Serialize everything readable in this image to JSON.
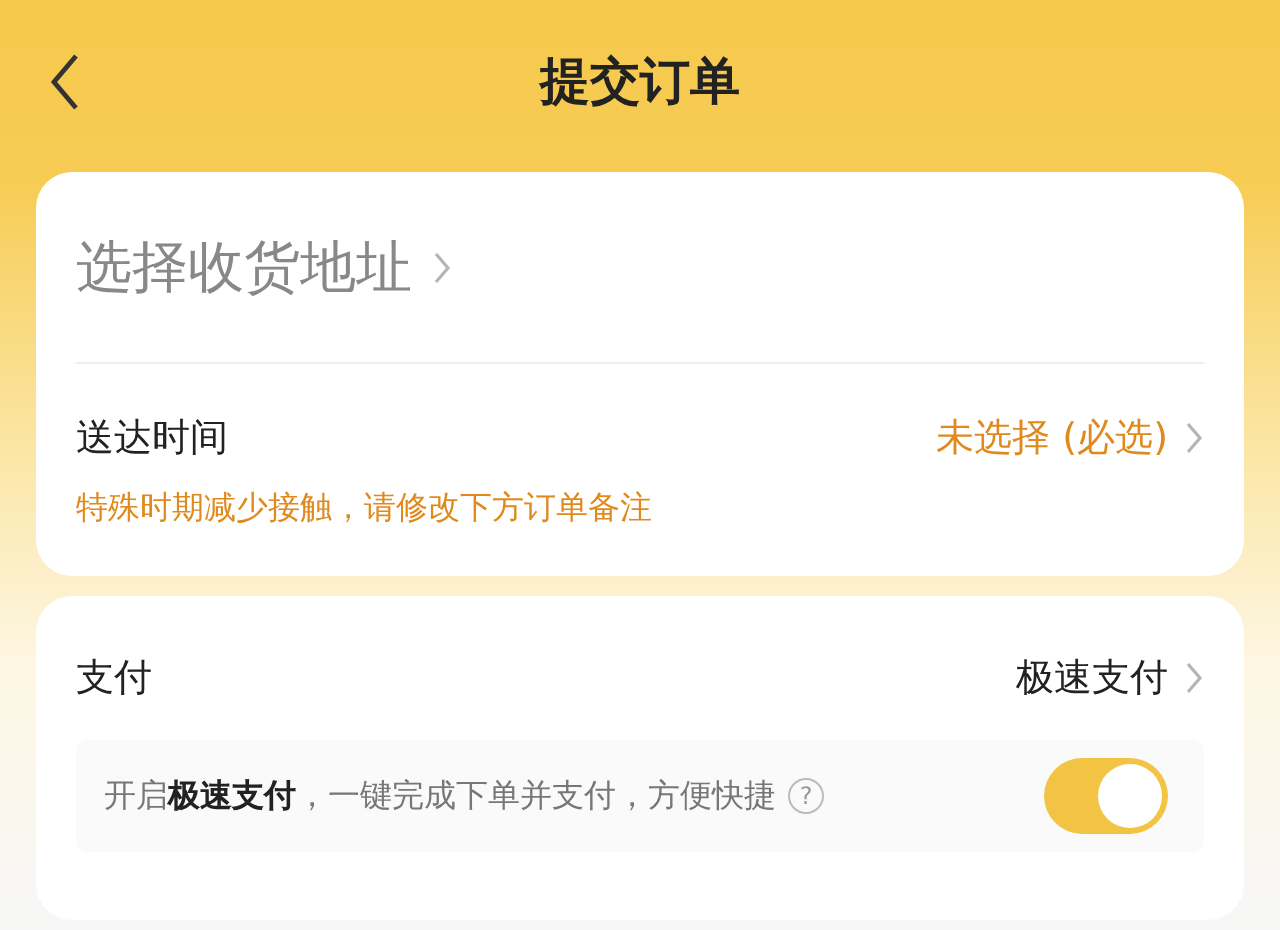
{
  "header": {
    "title": "提交订单"
  },
  "address": {
    "label": "选择收货地址"
  },
  "delivery": {
    "label": "送达时间",
    "value": "未选择 (必选)",
    "hint": "特殊时期减少接触，请修改下方订单备注"
  },
  "payment": {
    "label": "支付",
    "value": "极速支付"
  },
  "fast_pay": {
    "text": "开启**极速支付**，一键完成下单并支付，方便快捷",
    "help": "?",
    "on": true
  }
}
